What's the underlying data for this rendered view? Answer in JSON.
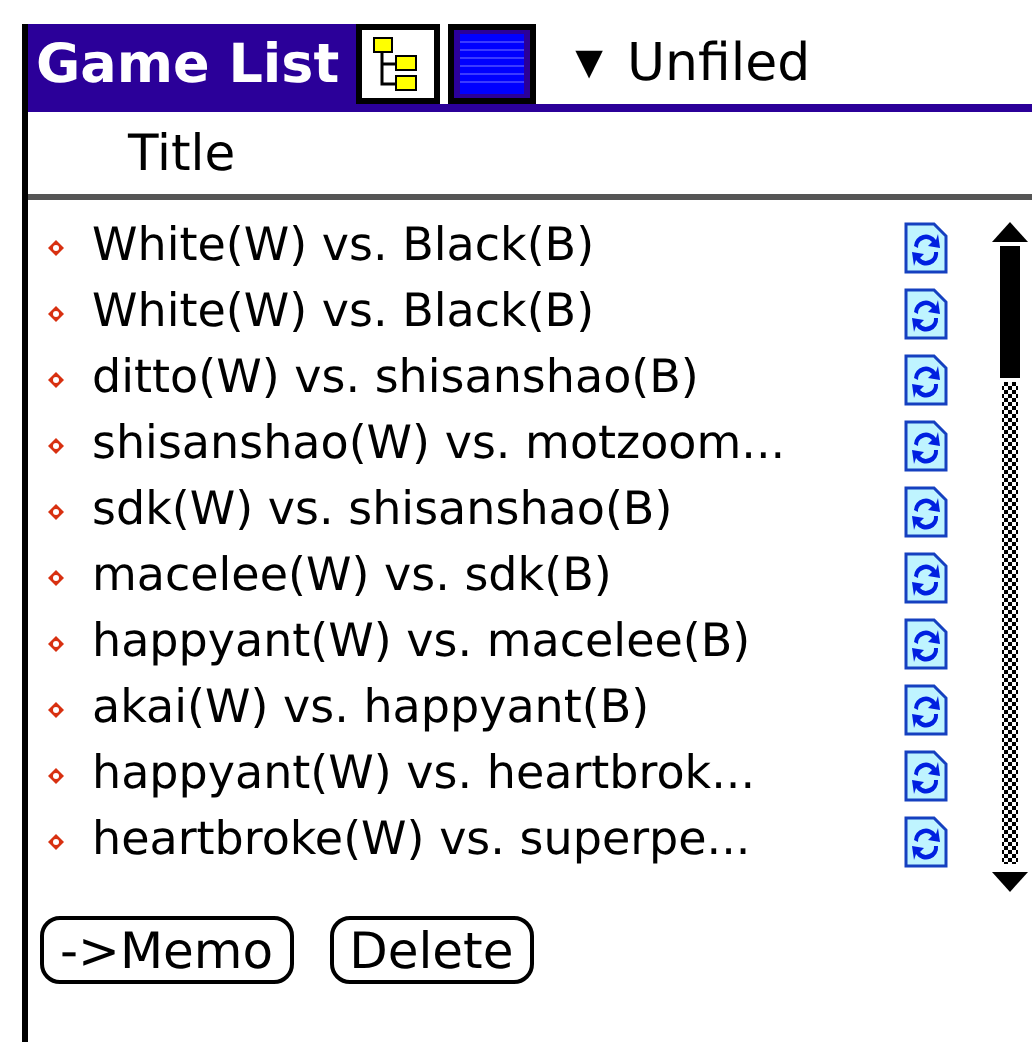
{
  "title": "Game List",
  "category": {
    "arrow": "▼",
    "label": "Unfiled"
  },
  "column_header": "Title",
  "games": [
    {
      "title": "White(W) vs. Black(B)"
    },
    {
      "title": "White(W) vs. Black(B)"
    },
    {
      "title": "ditto(W) vs. shisanshao(B)"
    },
    {
      "title": "shisanshao(W) vs. motzoom..."
    },
    {
      "title": "sdk(W) vs. shisanshao(B)"
    },
    {
      "title": "macelee(W) vs. sdk(B)"
    },
    {
      "title": "happyant(W) vs. macelee(B)"
    },
    {
      "title": "akai(W) vs. happyant(B)"
    },
    {
      "title": "happyant(W) vs. heartbrok..."
    },
    {
      "title": "heartbroke(W) vs. superpe..."
    }
  ],
  "buttons": [
    "->Memo",
    "Delete"
  ]
}
